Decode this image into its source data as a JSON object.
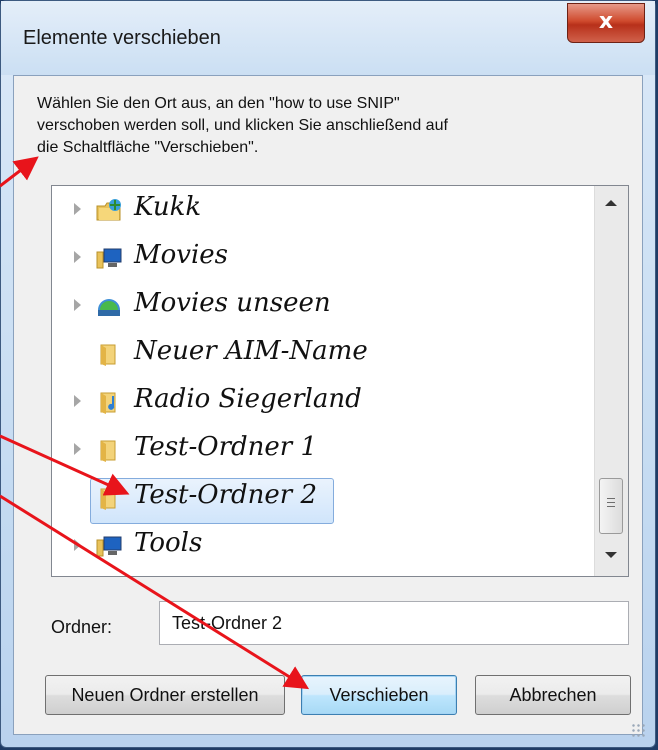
{
  "window": {
    "title": "Elemente verschieben",
    "close_glyph": "x"
  },
  "instruction": [
    "Wählen Sie den Ort aus, an den \"how to use SNIP\"",
    "verschoben werden soll, und klicken Sie anschließend auf",
    "die Schaltfläche \"Verschieben\"."
  ],
  "tree": {
    "items": [
      {
        "label": "Kukk",
        "icon": "network-folder-icon",
        "expandable": true,
        "selected": false
      },
      {
        "label": "Movies",
        "icon": "computer-folder-icon",
        "expandable": true,
        "selected": false
      },
      {
        "label": "Movies unseen",
        "icon": "network-share-folder-icon",
        "expandable": true,
        "selected": false
      },
      {
        "label": "Neuer AIM-Name",
        "icon": "folder-icon",
        "expandable": false,
        "selected": false
      },
      {
        "label": "Radio Siegerland",
        "icon": "music-folder-icon",
        "expandable": true,
        "selected": false
      },
      {
        "label": "Test-Ordner 1",
        "icon": "folder-icon",
        "expandable": true,
        "selected": false
      },
      {
        "label": "Test-Ordner 2",
        "icon": "folder-icon",
        "expandable": false,
        "selected": true
      },
      {
        "label": "Tools",
        "icon": "computer-folder-icon",
        "expandable": true,
        "selected": false
      }
    ]
  },
  "folder_field": {
    "label": "Ordner:",
    "value": "Test-Ordner 2"
  },
  "buttons": {
    "new_folder": "Neuen Ordner erstellen",
    "move": "Verschieben",
    "cancel": "Abbrechen"
  },
  "annotation": {
    "arrow_color": "#e8141b"
  },
  "colors": {
    "selection": "#d0e5fb",
    "close_button": "#cf4a2d"
  }
}
